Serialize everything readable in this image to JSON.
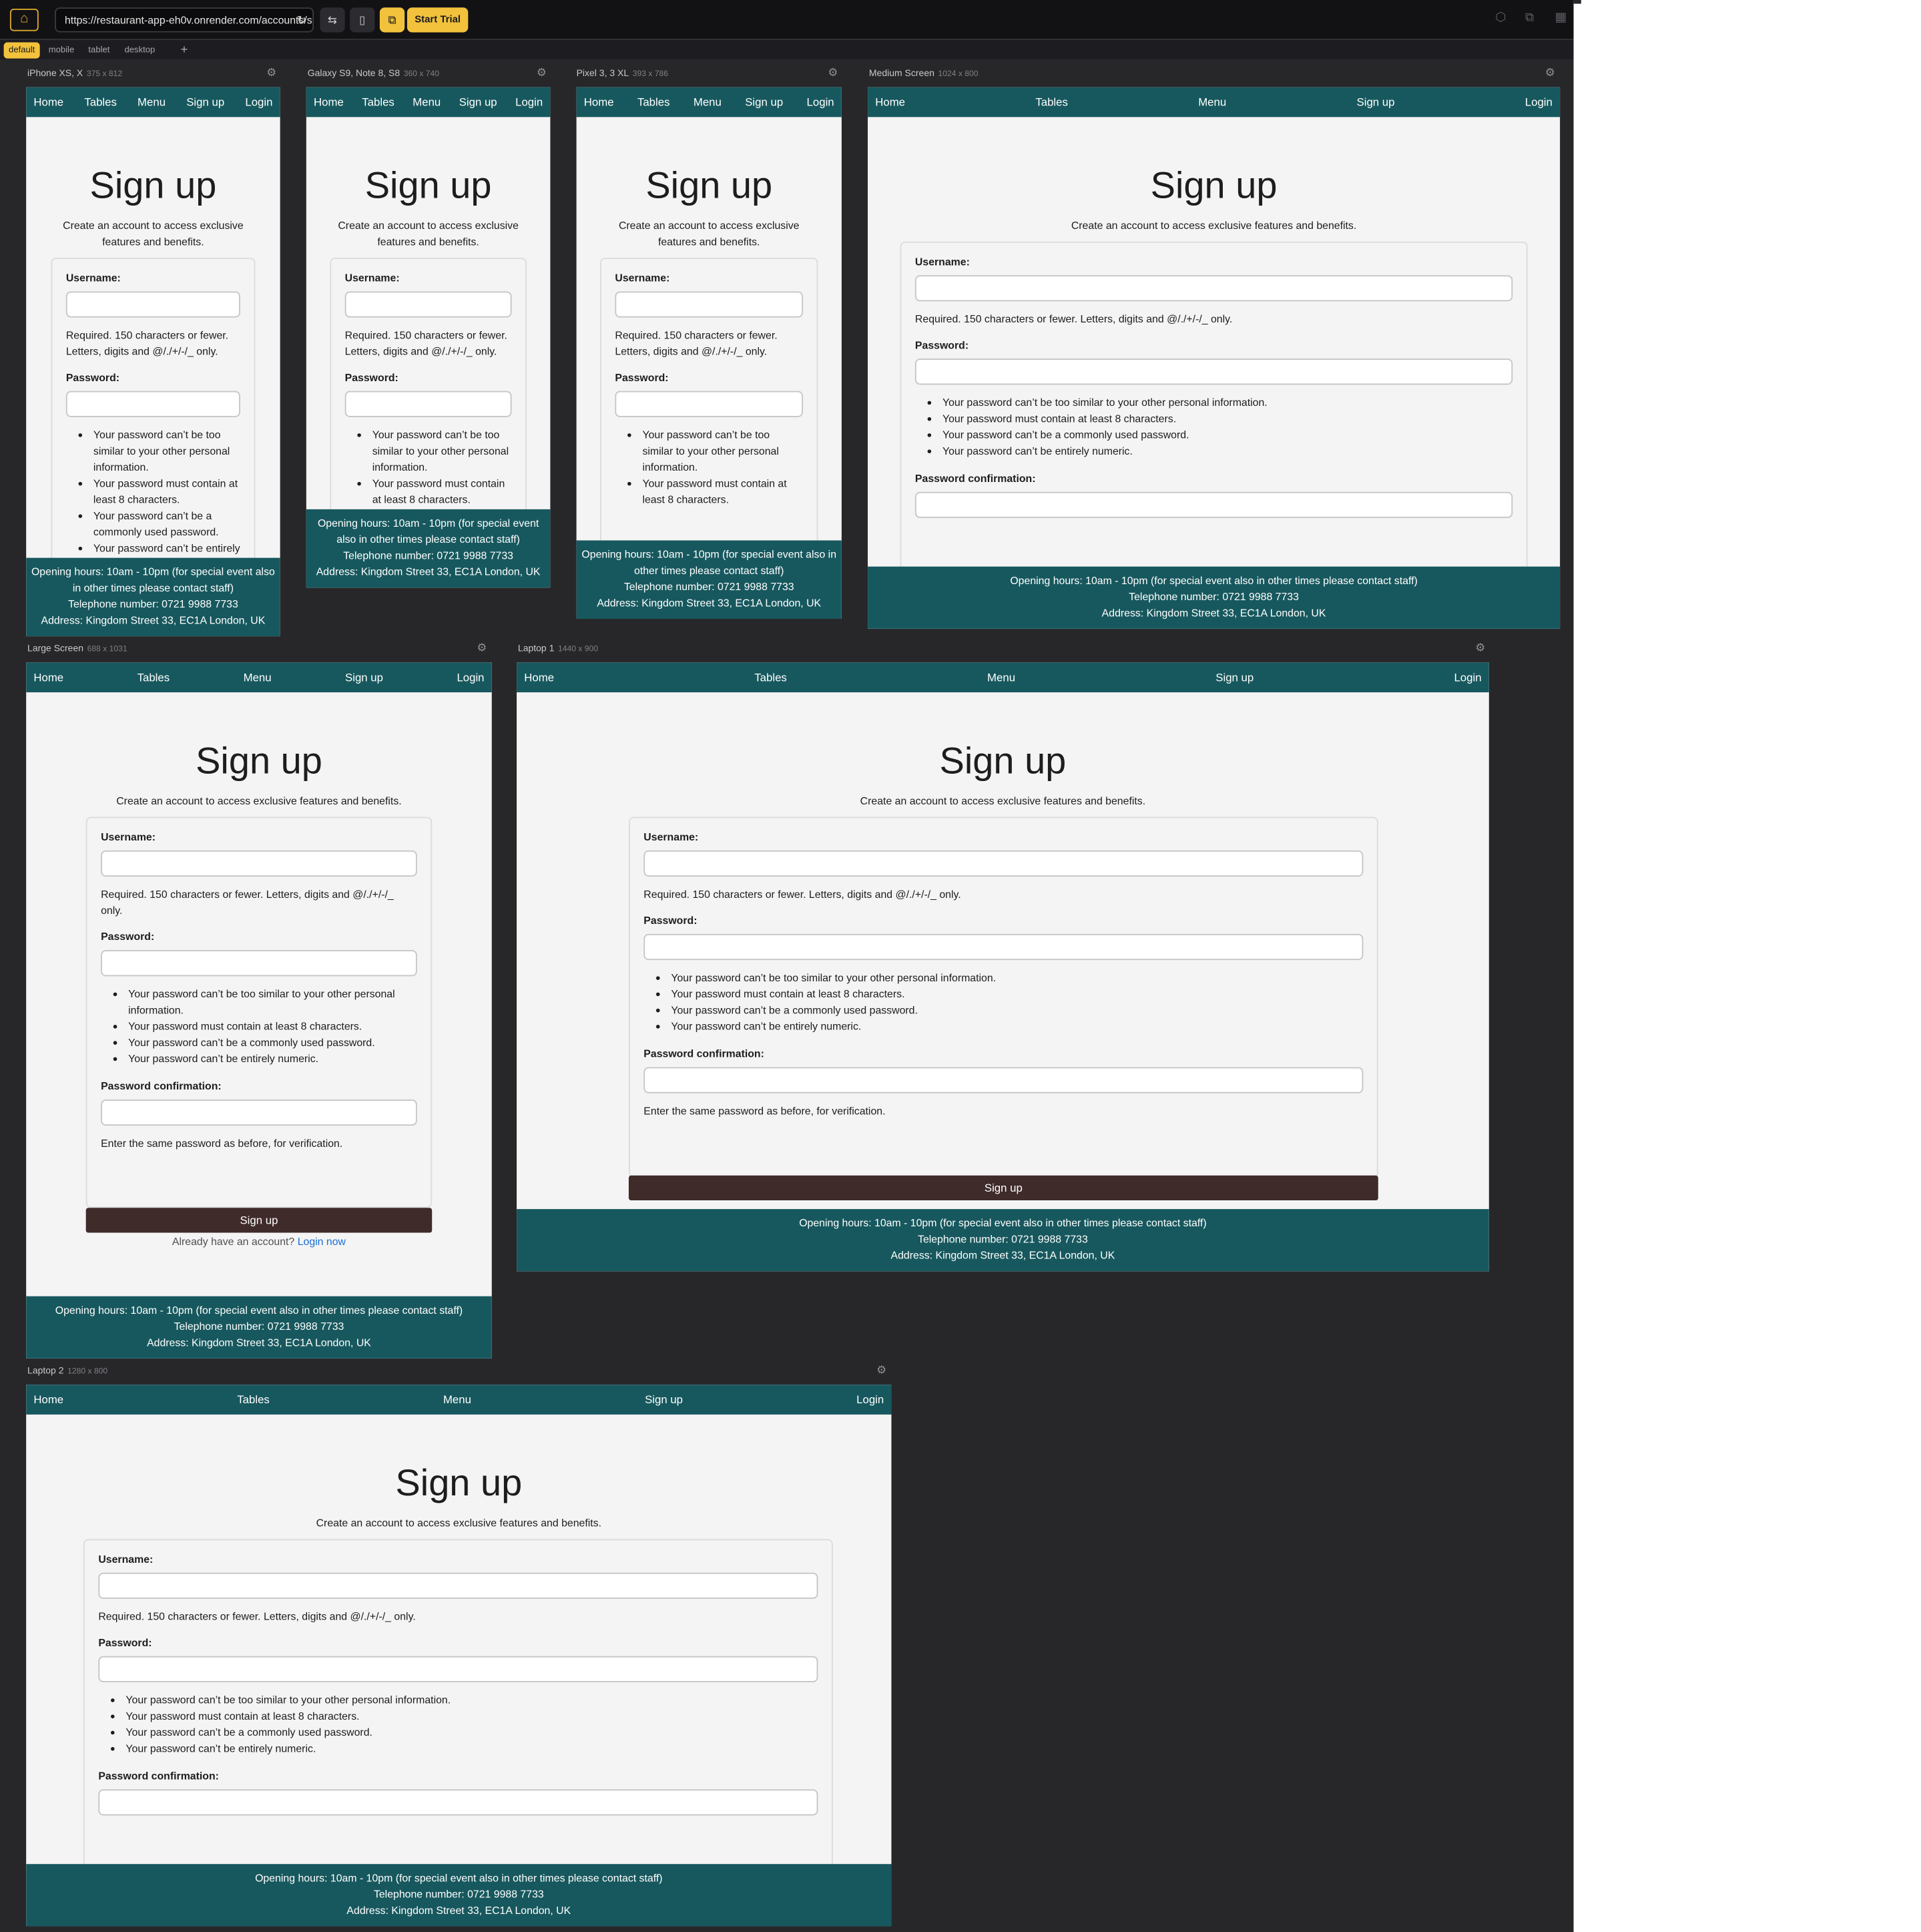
{
  "toolbar": {
    "url": "https://restaurant-app-eh0v.onrender.com/accounts/signup/",
    "start_trial": "Start Trial"
  },
  "device_tabs": [
    "default",
    "mobile",
    "tablet",
    "desktop"
  ],
  "add_tab": "+",
  "frames": [
    {
      "name": "iPhone XS, X",
      "dims": "375 x 812"
    },
    {
      "name": "Galaxy S9, Note 8, S8",
      "dims": "360 x 740"
    },
    {
      "name": "Pixel 3, 3 XL",
      "dims": "393 x 786"
    },
    {
      "name": "Medium Screen",
      "dims": "1024 x 800"
    },
    {
      "name": "Large Screen",
      "dims": "688 x 1031"
    },
    {
      "name": "Laptop 1",
      "dims": "1440 x 900"
    },
    {
      "name": "Laptop 2",
      "dims": "1280 x 800"
    }
  ],
  "site": {
    "nav": [
      "Home",
      "Tables",
      "Menu",
      "Sign up",
      "Login"
    ],
    "title": "Sign up",
    "subtitle": "Create an account to access exclusive features and benefits.",
    "username_label": "Username:",
    "username_help": "Required. 150 characters or fewer. Letters, digits and @/./+/-/_ only.",
    "password_label": "Password:",
    "password_rules": [
      "Your password can’t be too similar to your other personal information.",
      "Your password must contain at least 8 characters.",
      "Your password can’t be a commonly used password.",
      "Your password can’t be entirely numeric."
    ],
    "confirm_label": "Password confirmation:",
    "confirm_help": "Enter the same password as before, for verification.",
    "submit": "Sign up",
    "login_prompt": "Already have an account?",
    "login_link": "Login now",
    "footer": {
      "hours": "Opening hours: 10am - 10pm (for special event also in other times please contact staff)",
      "phone": "Telephone number: 0721 9988 7733",
      "address": "Address: Kingdom Street 33, EC1A London, UK"
    }
  }
}
